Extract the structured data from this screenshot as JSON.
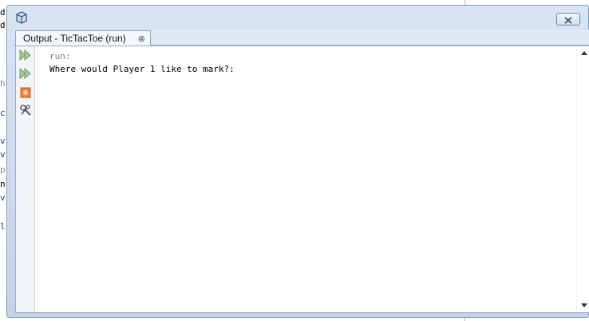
{
  "background_editor": {
    "visible_chars": [
      {
        "text": "d",
        "color": "#000000"
      },
      {
        "text": "d",
        "color": "#000000"
      },
      {
        "text": "h",
        "color": "#888888"
      },
      {
        "text": "c",
        "color": "#1a3d8f"
      },
      {
        "text": "v",
        "color": "#1a3d8f"
      },
      {
        "text": "v",
        "color": "#1a3d8f"
      },
      {
        "text": "p",
        "color": "#888888"
      },
      {
        "text": "n",
        "color": "#000000"
      },
      {
        "text": "v",
        "color": "#1a3d8f"
      },
      {
        "text": "l",
        "color": "#1a3d8f"
      }
    ]
  },
  "window": {
    "icon": "app-cube-icon",
    "close_icon": "close-icon"
  },
  "tab": {
    "label": "Output - TicTacToe (run)",
    "close_glyph": "⊗",
    "close_icon": "tab-close-icon"
  },
  "toolbar": {
    "buttons": [
      {
        "name": "rerun-button",
        "icon": "rerun-icon"
      },
      {
        "name": "rerun-with-options-button",
        "icon": "rerun-options-icon"
      },
      {
        "name": "stop-button",
        "icon": "stop-icon"
      },
      {
        "name": "settings-button",
        "icon": "wrench-icon"
      }
    ]
  },
  "output": {
    "lines": [
      {
        "text": "run:",
        "kind": "meta"
      },
      {
        "text": "Where would Player 1 like to mark?:",
        "kind": "out"
      }
    ]
  },
  "colors": {
    "meta_text": "#7f7f7f",
    "output_text": "#000000",
    "stop_orange": "#f08040"
  }
}
